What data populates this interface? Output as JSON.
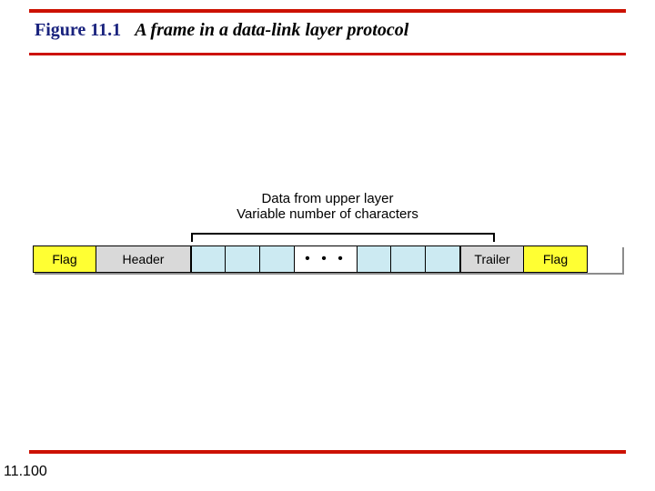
{
  "header": {
    "figure_number": "Figure 11.1",
    "figure_title": "A frame in a data-link layer protocol"
  },
  "footer": {
    "page_number": "11.100"
  },
  "diagram": {
    "annotation_line1": "Data from upper layer",
    "annotation_line2": "Variable number of characters",
    "fields": {
      "flag_start": "Flag",
      "header": "Header",
      "ellipsis": "• • •",
      "trailer": "Trailer",
      "flag_end": "Flag"
    },
    "payload_left_bytes": 3,
    "payload_right_bytes": 3
  }
}
